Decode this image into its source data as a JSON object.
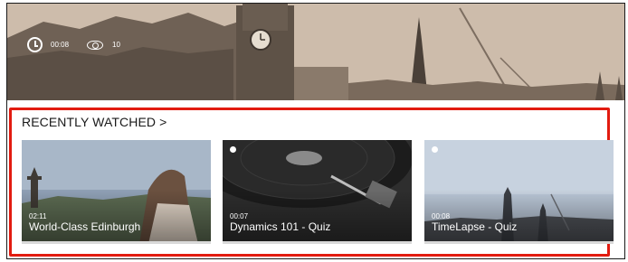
{
  "hero": {
    "duration": "00:08",
    "views": "10",
    "icons": {
      "duration": "clock-icon",
      "views": "eye-icon"
    }
  },
  "section": {
    "title": "RECENTLY WATCHED",
    "chevron": ">"
  },
  "cards": [
    {
      "duration": "02:11",
      "title": "World-Class Edinburgh",
      "indicator_icon": "film-icon"
    },
    {
      "duration": "00:07",
      "title": "Dynamics 101 - Quiz",
      "indicator_icon": "dot-icon"
    },
    {
      "duration": "00:08",
      "title": "TimeLapse - Quiz",
      "indicator_icon": "dot-icon"
    }
  ],
  "colors": {
    "highlight": "#e21b10",
    "text": "#1a1a1a",
    "overlay_text": "#ffffff"
  }
}
